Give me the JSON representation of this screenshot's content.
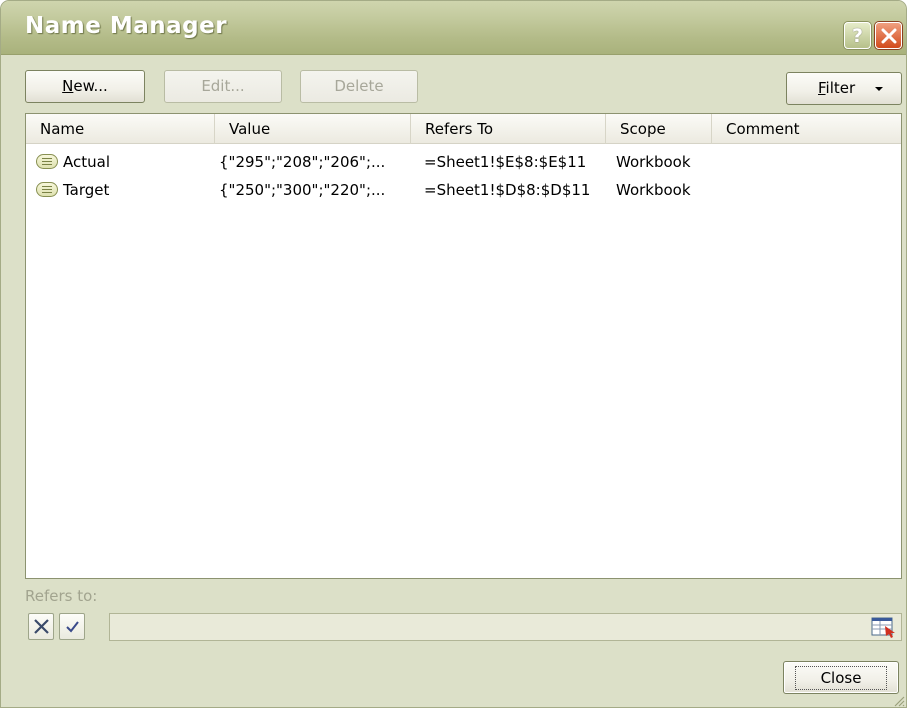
{
  "window": {
    "title": "Name Manager",
    "help_label": "?"
  },
  "toolbar": {
    "new_label": "New...",
    "new_accel": "N",
    "new_rest": "ew...",
    "edit_label": "Edit...",
    "delete_label": "Delete",
    "filter_label": "Filter",
    "filter_accel": "F",
    "filter_rest": "ilter"
  },
  "table": {
    "columns": [
      "Name",
      "Value",
      "Refers To",
      "Scope",
      "Comment"
    ],
    "rows": [
      {
        "name": "Actual",
        "value": "{\"295\";\"208\";\"206\";...",
        "refers_to": "=Sheet1!$E$8:$E$11",
        "scope": "Workbook",
        "comment": ""
      },
      {
        "name": "Target",
        "value": "{\"250\";\"300\";\"220\";...",
        "refers_to": "=Sheet1!$D$8:$D$11",
        "scope": "Workbook",
        "comment": ""
      }
    ]
  },
  "refers_to": {
    "label": "Refers to:",
    "value": ""
  },
  "footer": {
    "close_label": "Close"
  },
  "icons": {
    "name_row": "named-range-icon",
    "cancel": "x-icon",
    "accept": "checkmark-icon",
    "collapse": "collapse-dialog-icon"
  }
}
